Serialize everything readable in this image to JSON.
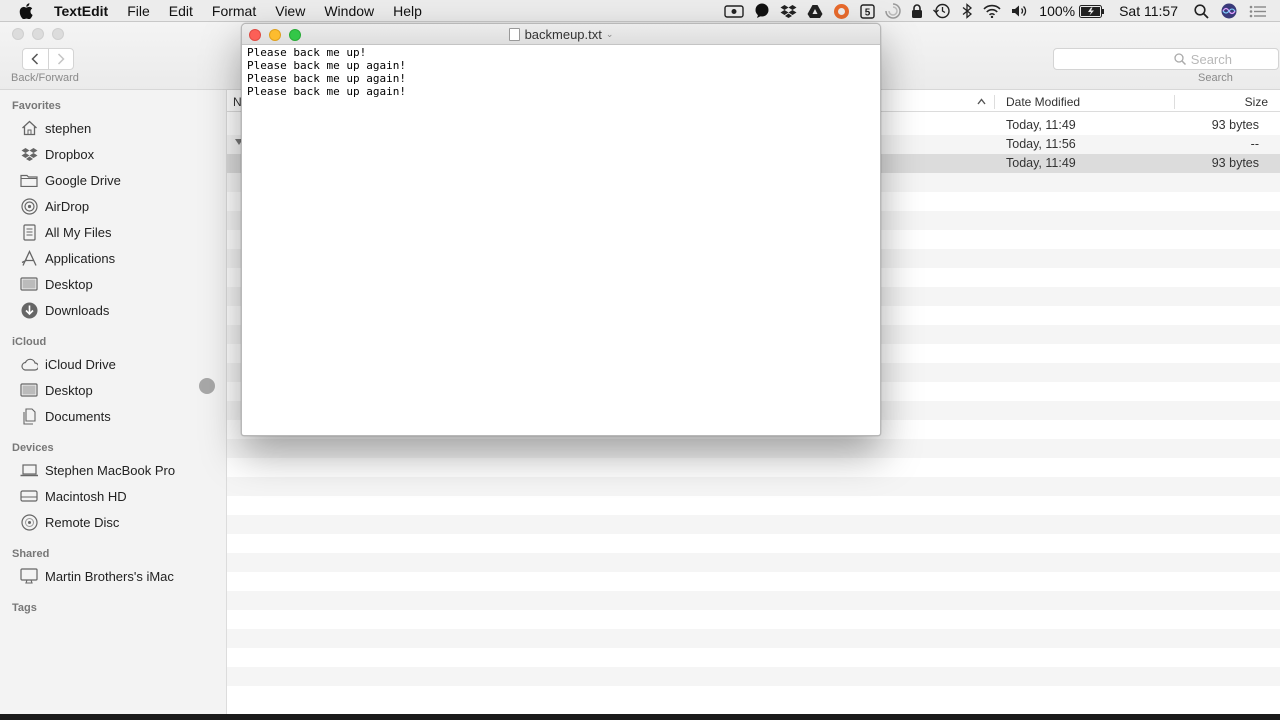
{
  "menubar": {
    "app_name": "TextEdit",
    "items": [
      "File",
      "Edit",
      "Format",
      "View",
      "Window",
      "Help"
    ],
    "battery": "100%",
    "clock": "Sat 11:57"
  },
  "finder": {
    "nav_label": "Back/Forward",
    "search_placeholder": "Search",
    "search_label": "Search",
    "sidebar": {
      "favorites_header": "Favorites",
      "favorites": [
        "stephen",
        "Dropbox",
        "Google Drive",
        "AirDrop",
        "All My Files",
        "Applications",
        "Desktop",
        "Downloads"
      ],
      "icloud_header": "iCloud",
      "icloud": [
        "iCloud Drive",
        "Desktop",
        "Documents"
      ],
      "devices_header": "Devices",
      "devices": [
        "Stephen MacBook Pro",
        "Macintosh HD",
        "Remote Disc"
      ],
      "shared_header": "Shared",
      "shared": [
        "Martin Brothers's iMac"
      ],
      "tags_header": "Tags"
    },
    "columns": {
      "name": "N",
      "date": "Date Modified",
      "size": "Size"
    },
    "rows": [
      {
        "date": "Today, 11:49",
        "size": "93 bytes"
      },
      {
        "date": "Today, 11:56",
        "size": "--"
      },
      {
        "date": "Today, 11:49",
        "size": "93 bytes"
      }
    ]
  },
  "textedit": {
    "title": "backmeup.txt",
    "lines": [
      "Please back me up!",
      "Please back me up again!",
      "Please back me up again!",
      "Please back me up again!"
    ]
  },
  "colors": {
    "close": "#fc5f57",
    "minimize": "#fdbc2e",
    "zoom": "#33c748"
  }
}
